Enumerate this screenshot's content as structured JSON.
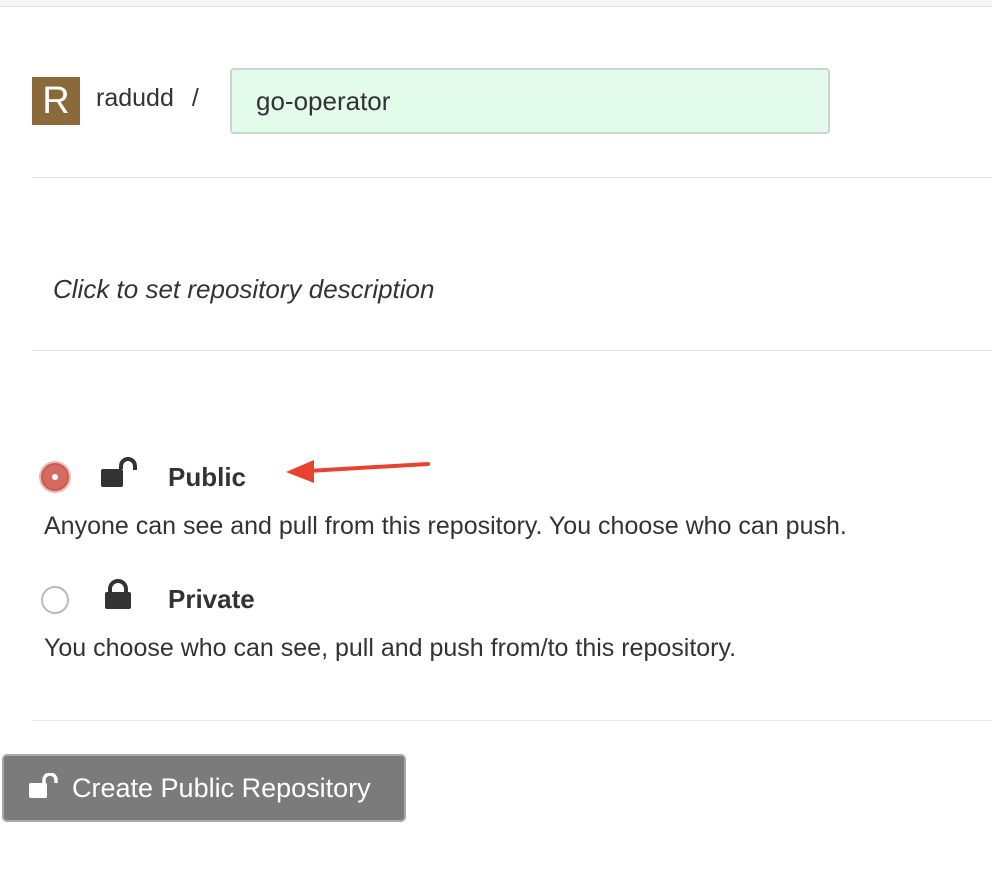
{
  "owner": {
    "avatar_letter": "R",
    "name": "radudd",
    "separator": "/"
  },
  "repository": {
    "name": "go-operator",
    "description_placeholder": "Click to set repository description"
  },
  "visibility": {
    "selected": "public",
    "options": [
      {
        "id": "public",
        "label": "Public",
        "description": "Anyone can see and pull from this repository. You choose who can push.",
        "icon": "unlock-icon"
      },
      {
        "id": "private",
        "label": "Private",
        "description": "You choose who can see, pull and push from/to this repository.",
        "icon": "lock-icon"
      }
    ]
  },
  "actions": {
    "create_label": "Create Public Repository",
    "create_icon": "unlock-icon"
  },
  "colors": {
    "avatar_bg": "#8a6a3a",
    "input_bg": "#e2fbea",
    "radio_selected": "#d36b62",
    "annotation_arrow": "#e8432e",
    "button_bg": "#7b7b7b"
  }
}
